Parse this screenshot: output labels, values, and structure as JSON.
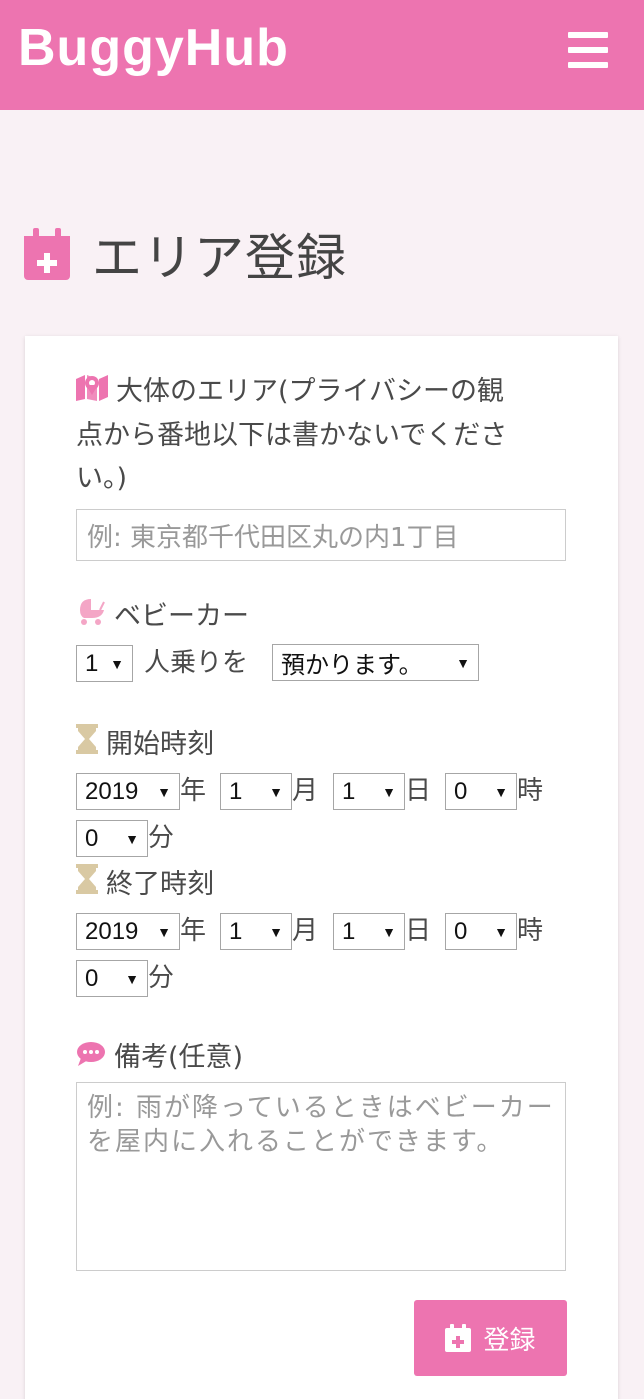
{
  "navbar": {
    "brand": "BuggyHub",
    "menu_icon": "hamburger-icon"
  },
  "page": {
    "title": "エリア登録",
    "title_icon": "calendar-plus-icon"
  },
  "area": {
    "label_line1": "大体のエリア(プライバシーの観",
    "label_line2": "点から番地以下は書かないでくださ",
    "label_line3": "い。)",
    "placeholder": "例: 東京都千代田区丸の内1丁目",
    "icon": "map-marker-icon"
  },
  "stroller": {
    "label": "ベビーカー",
    "icon": "stroller-icon",
    "count_value": "1",
    "people_text": "人乗りを",
    "action_value": "預かります。"
  },
  "start": {
    "label": "開始時刻",
    "icon": "hourglass-icon",
    "year": "2019",
    "month": "1",
    "day": "1",
    "hour": "0",
    "minute": "0"
  },
  "end": {
    "label": "終了時刻",
    "icon": "hourglass-icon",
    "year": "2019",
    "month": "1",
    "day": "1",
    "hour": "0",
    "minute": "0"
  },
  "units": {
    "year": "年",
    "month": "月",
    "day": "日",
    "hour": "時",
    "minute": "分"
  },
  "notes": {
    "label": "備考(任意)",
    "icon": "comment-icon",
    "placeholder": "例: 雨が降っているときはベビーカーを屋内に入れることができます。"
  },
  "submit": {
    "label": "登録",
    "icon": "calendar-plus-icon"
  },
  "colors": {
    "accent": "#ed74b0",
    "hourglass": "#d9c9a3",
    "stroller": "#f4a6c6"
  }
}
